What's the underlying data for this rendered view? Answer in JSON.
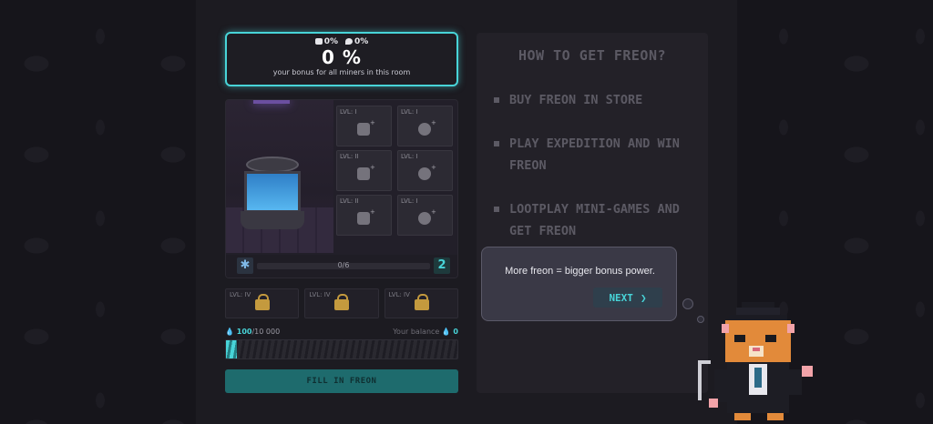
{
  "bonus": {
    "stat_cooler": "0%",
    "stat_drop": "0%",
    "value": "0 %",
    "caption": "your bonus for all miners in this room"
  },
  "room": {
    "slots": [
      {
        "label": "LVL: I"
      },
      {
        "label": "LVL: I"
      },
      {
        "label": "LVL: II"
      },
      {
        "label": "LVL: I"
      },
      {
        "label": "LVL: II"
      },
      {
        "label": "LVL: I"
      }
    ],
    "progress_text": "0/6",
    "progress_value": 0,
    "room_number": "2"
  },
  "locked_slots": [
    {
      "label": "LVL: IV"
    },
    {
      "label": "LVL: IV"
    },
    {
      "label": "LVL: IV"
    }
  ],
  "freon": {
    "current": "100",
    "max": "/10 000",
    "balance_label": "Your balance",
    "balance_value": "0",
    "fill_fraction": 0.01,
    "fill_button": "FILL IN FREON"
  },
  "info": {
    "title": "HOW TO GET FREON?",
    "items": [
      "BUY FREON IN STORE",
      "PLAY EXPEDITION AND WIN FREON",
      "LOOTPLAY MINI-GAMES AND GET FREON"
    ]
  },
  "tooltip": {
    "text": "More freon = bigger bonus power.",
    "next_label": "NEXT",
    "next_icon": "chevron-right-icon"
  },
  "colors": {
    "accent": "#48d4d8",
    "background": "#141319",
    "panel": "#232128"
  }
}
